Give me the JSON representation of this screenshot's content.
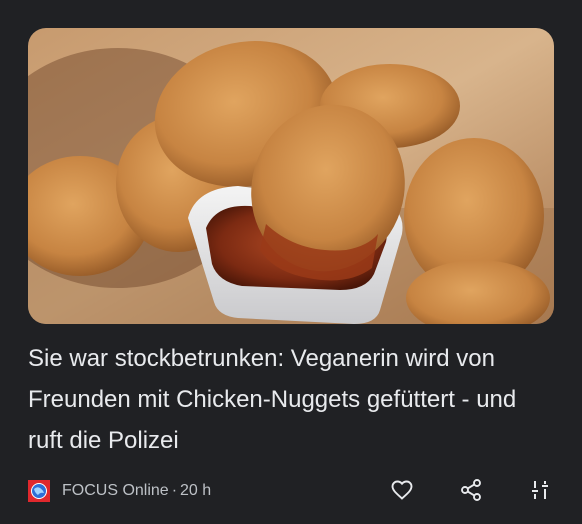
{
  "article": {
    "image_alt": "Chicken-Nuggets mit Dip-Soße",
    "headline": "Sie war stockbetrunken: Veganerin wird von Freunden mit Chicken-Nuggets gefüttert - und ruft die Polizei",
    "source": "FOCUS Online",
    "separator": "·",
    "age": "20 h"
  },
  "actions": {
    "like_icon": "heart-outline-icon",
    "share_icon": "share-icon",
    "more_icon": "tune-sliders-icon"
  },
  "colors": {
    "background": "#202124",
    "text_primary": "#e8eaed",
    "text_secondary": "#bdc1c6",
    "logo_red": "#e0282d",
    "logo_blue": "#2f6fd6"
  }
}
